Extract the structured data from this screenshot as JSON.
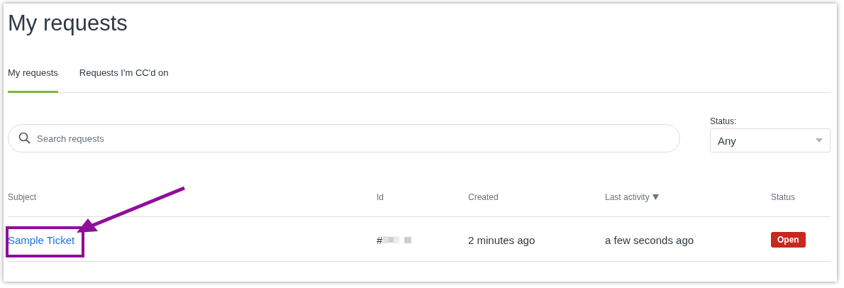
{
  "page": {
    "title": "My requests"
  },
  "tabs": [
    {
      "label": "My requests",
      "selected": true
    },
    {
      "label": "Requests I'm CC'd on",
      "selected": false
    }
  ],
  "search": {
    "placeholder": "Search requests"
  },
  "status_filter": {
    "label": "Status:",
    "value": "Any"
  },
  "table": {
    "columns": [
      {
        "label": "Subject",
        "sorted": false
      },
      {
        "label": "Id",
        "sorted": false
      },
      {
        "label": "Created",
        "sorted": false
      },
      {
        "label": "Last activity",
        "sorted": true
      },
      {
        "label": "Status",
        "sorted": false
      }
    ],
    "rows": [
      {
        "subject": "Sample Ticket",
        "id": "#",
        "id_redacted": true,
        "created": "2 minutes ago",
        "last_activity": "a few seconds ago",
        "status": "Open"
      }
    ]
  }
}
